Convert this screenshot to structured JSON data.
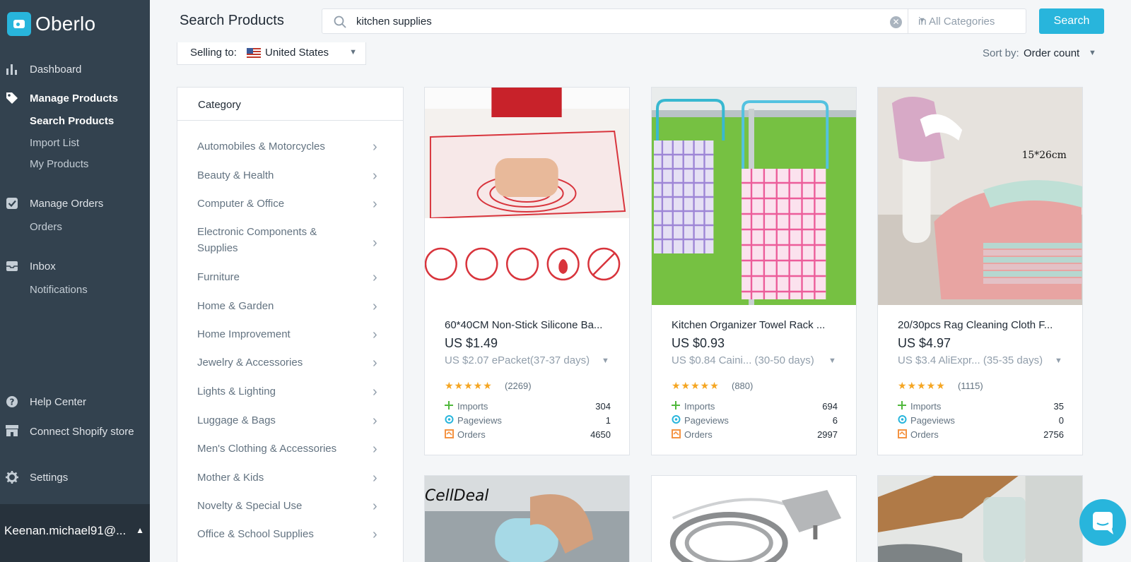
{
  "app": {
    "name": "Oberlo"
  },
  "sidebar": {
    "nav": [
      {
        "label": "Dashboard",
        "icon": "bar-chart-icon"
      },
      {
        "label": "Manage Products",
        "icon": "tag-icon"
      },
      {
        "label": "Manage Orders",
        "icon": "checkbox-icon"
      },
      {
        "label": "Inbox",
        "icon": "inbox-icon"
      },
      {
        "label": "Help Center",
        "icon": "question-icon"
      },
      {
        "label": "Connect Shopify store",
        "icon": "store-icon"
      },
      {
        "label": "Settings",
        "icon": "gear-icon"
      }
    ],
    "products_sub": [
      "Search Products",
      "Import List",
      "My Products"
    ],
    "orders_sub": [
      "Orders"
    ],
    "inbox_sub": [
      "Notifications"
    ],
    "user": "Keenan.michael91@..."
  },
  "header": {
    "title": "Search Products",
    "search_value": "kitchen supplies",
    "category": "in All Categories",
    "search_button": "Search",
    "selling_to_label": "Selling to:",
    "selling_to_value": "United States",
    "sort_label": "Sort by:",
    "sort_value": "Order count"
  },
  "categories": {
    "title": "Category",
    "items": [
      "Automobiles & Motorcycles",
      "Beauty & Health",
      "Computer & Office",
      "Electronic Components & Supplies",
      "Furniture",
      "Home & Garden",
      "Home Improvement",
      "Jewelry & Accessories",
      "Lights & Lighting",
      "Luggage & Bags",
      "Men's Clothing & Accessories",
      "Mother & Kids",
      "Novelty & Special Use",
      "Office & School Supplies"
    ]
  },
  "stat_labels": {
    "imports": "Imports",
    "pageviews": "Pageviews",
    "orders": "Orders"
  },
  "products": [
    {
      "title": "60*40CM Non-Stick Silicone Ba...",
      "price": "US $1.49",
      "shipping": "US $2.07 ePacket(37-37 days)",
      "rating": 5,
      "reviews": "(2269)",
      "imports": "304",
      "pageviews": "1",
      "orders": "4650"
    },
    {
      "title": "Kitchen Organizer Towel Rack ...",
      "price": "US $0.93",
      "shipping": "US $0.84 Caini... (30-50 days)",
      "rating": 5,
      "reviews": "(880)",
      "imports": "694",
      "pageviews": "6",
      "orders": "2997"
    },
    {
      "title": "20/30pcs Rag Cleaning Cloth F...",
      "price": "US $4.97",
      "shipping": "US $3.4 AliExpr... (35-35 days)",
      "rating": 5,
      "reviews": "(1115)",
      "imports": "35",
      "pageviews": "0",
      "orders": "2756"
    }
  ],
  "image_texts": {
    "cloth_size": "15*26cm",
    "brand": "CellDeal"
  },
  "colors": {
    "sidebar": "#33424f",
    "accent": "#28b5dc",
    "star": "#f5a623"
  }
}
